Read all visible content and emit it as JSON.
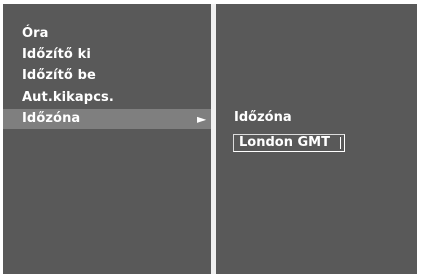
{
  "menu": {
    "items": [
      {
        "label": "Óra"
      },
      {
        "label": "Időzítő ki"
      },
      {
        "label": "Időzítő be"
      },
      {
        "label": "Aut.kikapcs."
      },
      {
        "label": "Időzóna",
        "selected": true
      }
    ],
    "submenu_arrow": "►"
  },
  "submenu": {
    "title": "Időzóna",
    "value": "London GMT"
  },
  "colors": {
    "panel": "#595959",
    "highlight": "#7f7f7f",
    "text": "#ffffff",
    "divider": "#f0f0f0"
  }
}
